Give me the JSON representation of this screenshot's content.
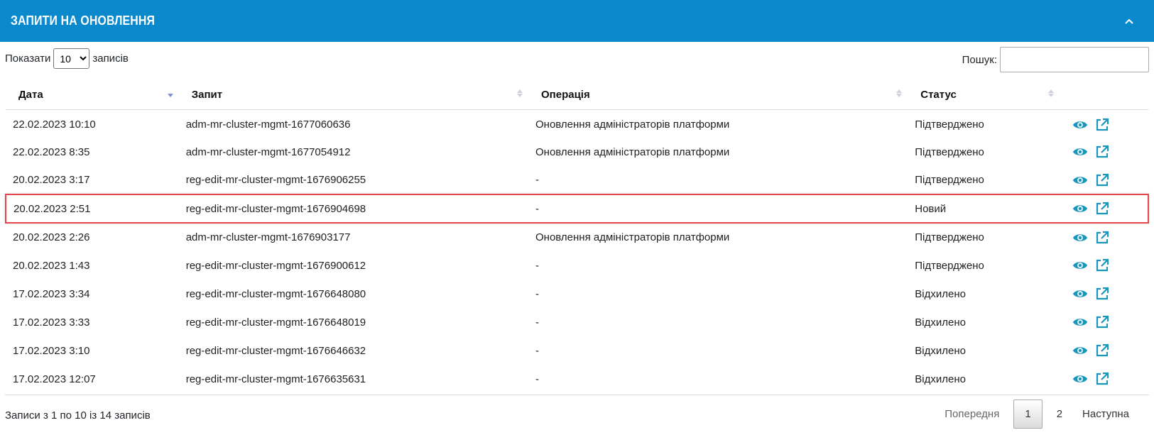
{
  "panel": {
    "title": "Запити на оновлення",
    "collapse_icon": "chevron-up-icon"
  },
  "length_control": {
    "prefix": "Показати",
    "selected": "10",
    "suffix": "записів"
  },
  "search": {
    "label": "Пошук:",
    "value": "",
    "placeholder": ""
  },
  "table": {
    "columns": [
      "Дата",
      "Запит",
      "Операція",
      "Статус"
    ],
    "sorted_column": "Дата",
    "rows": [
      {
        "date": "22.02.2023 10:10",
        "request": "adm-mr-cluster-mgmt-1677060636",
        "operation": "Оновлення адміністраторів платформи",
        "status": "Підтверджено",
        "highlighted": false
      },
      {
        "date": "22.02.2023 8:35",
        "request": "adm-mr-cluster-mgmt-1677054912",
        "operation": "Оновлення адміністраторів платформи",
        "status": "Підтверджено",
        "highlighted": false
      },
      {
        "date": "20.02.2023 3:17",
        "request": "reg-edit-mr-cluster-mgmt-1676906255",
        "operation": "-",
        "status": "Підтверджено",
        "highlighted": false
      },
      {
        "date": "20.02.2023 2:51",
        "request": "reg-edit-mr-cluster-mgmt-1676904698",
        "operation": "-",
        "status": "Новий",
        "highlighted": true
      },
      {
        "date": "20.02.2023 2:26",
        "request": "adm-mr-cluster-mgmt-1676903177",
        "operation": "Оновлення адміністраторів платформи",
        "status": "Підтверджено",
        "highlighted": false
      },
      {
        "date": "20.02.2023 1:43",
        "request": "reg-edit-mr-cluster-mgmt-1676900612",
        "operation": "-",
        "status": "Підтверджено",
        "highlighted": false
      },
      {
        "date": "17.02.2023 3:34",
        "request": "reg-edit-mr-cluster-mgmt-1676648080",
        "operation": "-",
        "status": "Відхилено",
        "highlighted": false
      },
      {
        "date": "17.02.2023 3:33",
        "request": "reg-edit-mr-cluster-mgmt-1676648019",
        "operation": "-",
        "status": "Відхилено",
        "highlighted": false
      },
      {
        "date": "17.02.2023 3:10",
        "request": "reg-edit-mr-cluster-mgmt-1676646632",
        "operation": "-",
        "status": "Відхилено",
        "highlighted": false
      },
      {
        "date": "17.02.2023 12:07",
        "request": "reg-edit-mr-cluster-mgmt-1676635631",
        "operation": "-",
        "status": "Відхилено",
        "highlighted": false
      }
    ],
    "row_action_icons": [
      "eye-icon",
      "external-link-icon"
    ]
  },
  "footer": {
    "info": "Записи з 1 по 10 із 14 записів",
    "pagination": {
      "previous": "Попередня",
      "pages": [
        "1",
        "2"
      ],
      "current": "1",
      "next": "Наступна"
    }
  },
  "colors": {
    "header_bg": "#0a8acd",
    "icon": "#1a96be",
    "highlight_border": "#e5454d"
  }
}
